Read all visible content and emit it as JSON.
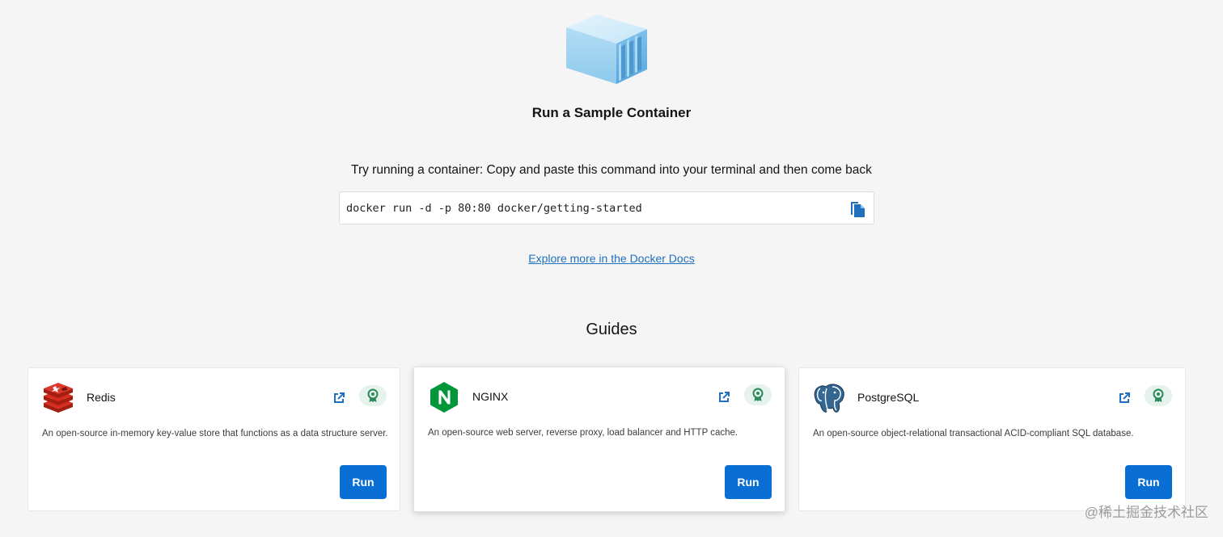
{
  "hero": {
    "icon": "container-box-icon",
    "title": "Run a Sample Container"
  },
  "instructions": "Try running a container: Copy and paste this command into your terminal and then come back",
  "command": {
    "text": "docker run -d -p 80:80 docker/getting-started",
    "copy_icon": "copy-icon"
  },
  "docs_link": "Explore more in the Docker Docs",
  "guides": {
    "title": "Guides",
    "items": [
      {
        "name": "Redis",
        "description": "An open-source in-memory key-value store that functions as a data structure server.",
        "run_label": "Run",
        "logo": "redis-logo"
      },
      {
        "name": "NGINX",
        "description": "An open-source web server, reverse proxy, load balancer and HTTP cache.",
        "run_label": "Run",
        "logo": "nginx-logo"
      },
      {
        "name": "PostgreSQL",
        "description": "An open-source object-relational transactional ACID-compliant SQL database.",
        "run_label": "Run",
        "logo": "postgresql-logo"
      }
    ]
  },
  "watermark": "@稀土掘金技术社区",
  "colors": {
    "background": "#f5f5f5",
    "primary_button": "#0a6fd4",
    "link": "#1f6fbf",
    "badge_bg": "#e6f2ec",
    "badge_icon": "#2a8a5a"
  }
}
